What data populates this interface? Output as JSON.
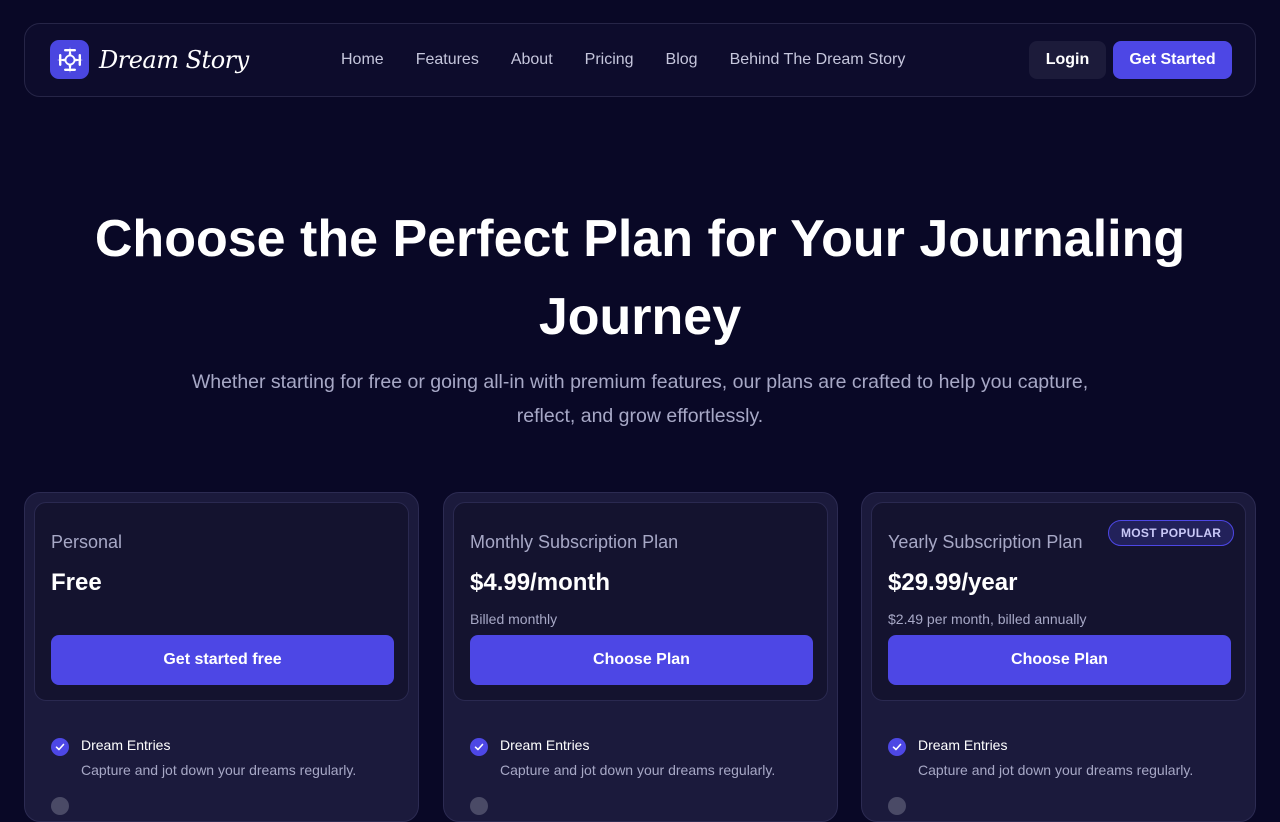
{
  "brand": {
    "name": "Dream Story"
  },
  "nav": {
    "links": [
      "Home",
      "Features",
      "About",
      "Pricing",
      "Blog",
      "Behind The Dream Story"
    ],
    "login_label": "Login",
    "get_started_label": "Get Started"
  },
  "hero": {
    "title": "Choose the Perfect Plan for Your Journaling Journey",
    "subtitle": "Whether starting for free or going all-in with premium features, our plans are crafted to help you capture, reflect, and grow effortlessly."
  },
  "plans": [
    {
      "name": "Personal",
      "price": "Free",
      "billing": "",
      "button": "Get started free",
      "badge": "",
      "feature": {
        "title": "Dream Entries",
        "desc": "Capture and jot down your dreams regularly."
      }
    },
    {
      "name": "Monthly Subscription Plan",
      "price": "$4.99/month",
      "billing": "Billed monthly",
      "button": "Choose Plan",
      "badge": "",
      "feature": {
        "title": "Dream Entries",
        "desc": "Capture and jot down your dreams regularly."
      }
    },
    {
      "name": "Yearly Subscription Plan",
      "price": "$29.99/year",
      "billing": "$2.49 per month, billed annually",
      "button": "Choose Plan",
      "badge": "MOST POPULAR",
      "feature": {
        "title": "Dream Entries",
        "desc": "Capture and jot down your dreams regularly."
      }
    }
  ],
  "colors": {
    "background": "#090826",
    "accent": "#4d47e5",
    "card": "#1b1a3c",
    "muted_text": "#a7a8c6"
  },
  "icons": {
    "logo": "compass-star-icon",
    "feature_check": "check-circle-icon"
  }
}
